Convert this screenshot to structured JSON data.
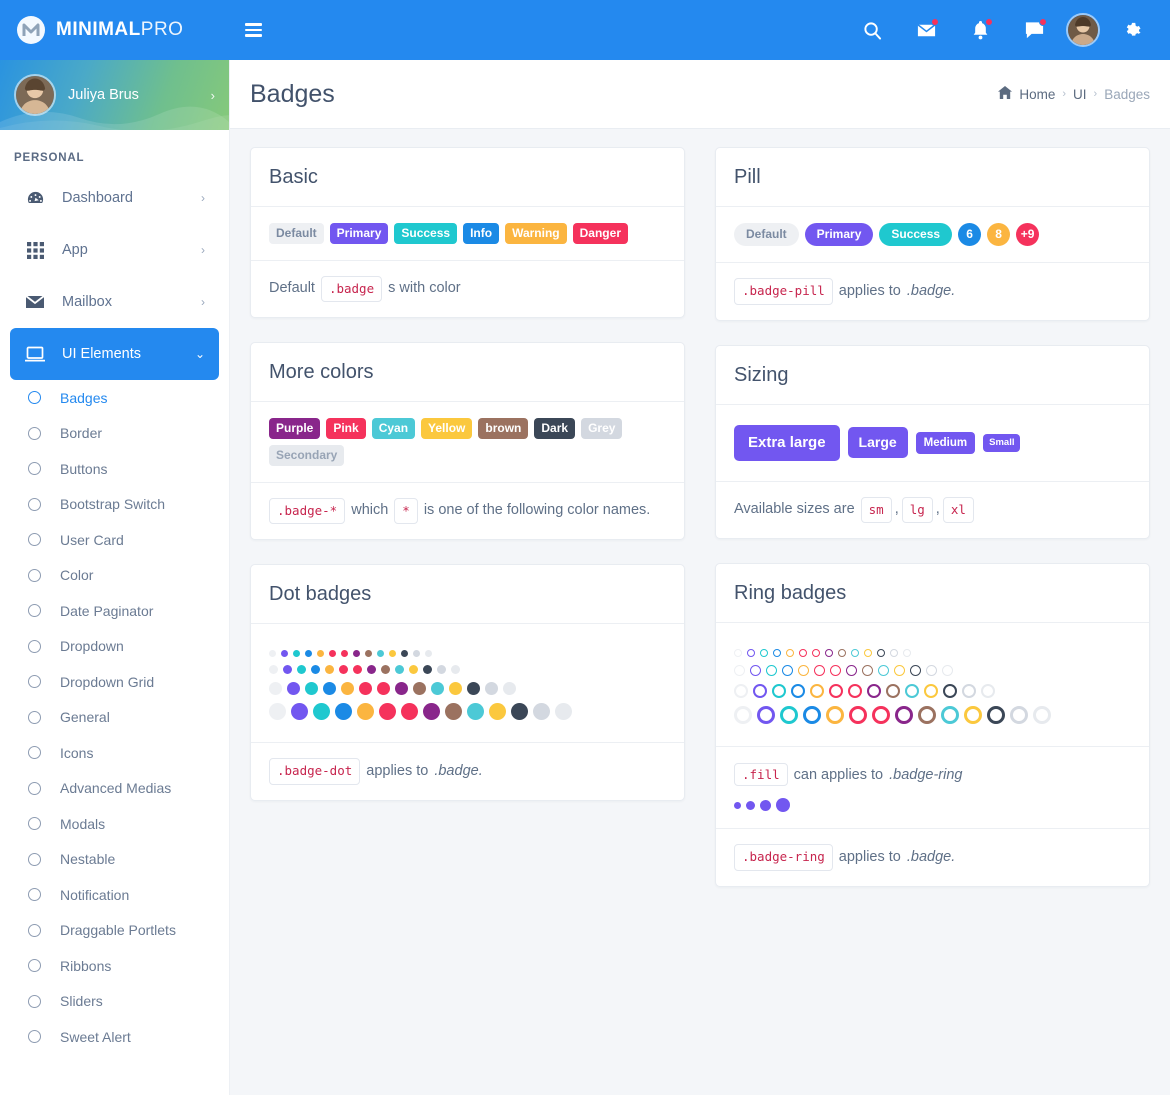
{
  "brand": {
    "name_bold": "MINIMAL",
    "name_light": "PRO",
    "logo_icon": "m-logo-icon"
  },
  "topbar": {
    "menu_icon": "hamburger-icon",
    "icons": [
      {
        "name": "search-icon",
        "badge": false
      },
      {
        "name": "mail-icon",
        "badge": true
      },
      {
        "name": "bell-icon",
        "badge": true
      },
      {
        "name": "chat-icon",
        "badge": true
      }
    ],
    "avatar_name": "user-avatar",
    "settings_icon": "gear-icon",
    "accent": "#2489ef"
  },
  "sidebar": {
    "user": {
      "name": "Juliya Brus",
      "chevron": "›"
    },
    "section_label": "PERSONAL",
    "items": [
      {
        "label": "Dashboard",
        "icon": "speedometer-icon",
        "chevron": "›",
        "active": false
      },
      {
        "label": "App",
        "icon": "grid-icon",
        "chevron": "›",
        "active": false
      },
      {
        "label": "Mailbox",
        "icon": "envelope-icon",
        "chevron": "›",
        "active": false
      },
      {
        "label": "UI Elements",
        "icon": "monitor-icon",
        "chevron": "⌄",
        "active": true
      }
    ],
    "subitems": [
      {
        "label": "Badges",
        "active": true
      },
      {
        "label": "Border",
        "active": false
      },
      {
        "label": "Buttons",
        "active": false
      },
      {
        "label": "Bootstrap Switch",
        "active": false
      },
      {
        "label": "User Card",
        "active": false
      },
      {
        "label": "Color",
        "active": false
      },
      {
        "label": "Date Paginator",
        "active": false
      },
      {
        "label": "Dropdown",
        "active": false
      },
      {
        "label": "Dropdown Grid",
        "active": false
      },
      {
        "label": "General",
        "active": false
      },
      {
        "label": "Icons",
        "active": false
      },
      {
        "label": "Advanced Medias",
        "active": false
      },
      {
        "label": "Modals",
        "active": false
      },
      {
        "label": "Nestable",
        "active": false
      },
      {
        "label": "Notification",
        "active": false
      },
      {
        "label": "Draggable Portlets",
        "active": false
      },
      {
        "label": "Ribbons",
        "active": false
      },
      {
        "label": "Sliders",
        "active": false
      },
      {
        "label": "Sweet Alert",
        "active": false
      }
    ]
  },
  "page": {
    "title": "Badges",
    "breadcrumb": {
      "home_icon": "home-icon",
      "home": "Home",
      "sep": "›",
      "middle": "UI",
      "current": "Badges"
    }
  },
  "palette": {
    "default": "#eef0f3",
    "default_text": "#7b8aa1",
    "primary": "#7257f0",
    "success": "#1fc8cf",
    "info": "#1b8ae5",
    "warning": "#fbb540",
    "danger": "#f5325c",
    "purple": "#89268b",
    "pink": "#f5325c",
    "cyan": "#4cc9d6",
    "yellow": "#fbc83e",
    "brown": "#9b7260",
    "dark": "#3b4757",
    "grey": "#d3d8e0",
    "secondary": "#e7eaee"
  },
  "cards": {
    "basic": {
      "title": "Basic",
      "badges": [
        {
          "label": "Default",
          "color": "default"
        },
        {
          "label": "Primary",
          "color": "primary"
        },
        {
          "label": "Success",
          "color": "success"
        },
        {
          "label": "Info",
          "color": "info"
        },
        {
          "label": "Warning",
          "color": "warning"
        },
        {
          "label": "Danger",
          "color": "danger"
        }
      ],
      "footer": {
        "pre": "Default",
        "code": ".badge",
        "post": "s with color"
      }
    },
    "pill": {
      "title": "Pill",
      "badges": [
        {
          "label": "Default",
          "color": "default",
          "shape": "pill"
        },
        {
          "label": "Primary",
          "color": "primary",
          "shape": "pill"
        },
        {
          "label": "Success",
          "color": "success",
          "shape": "pill"
        },
        {
          "label": "6",
          "color": "info",
          "shape": "circle"
        },
        {
          "label": "8",
          "color": "warning",
          "shape": "circle"
        },
        {
          "label": "+9",
          "color": "danger",
          "shape": "circle"
        }
      ],
      "footer": {
        "code": ".badge-pill",
        "post": "applies to",
        "em": ".badge."
      }
    },
    "more_colors": {
      "title": "More colors",
      "badges": [
        {
          "label": "Purple",
          "color": "purple"
        },
        {
          "label": "Pink",
          "color": "pink"
        },
        {
          "label": "Cyan",
          "color": "cyan"
        },
        {
          "label": "Yellow",
          "color": "yellow"
        },
        {
          "label": "brown",
          "color": "brown"
        },
        {
          "label": "Dark",
          "color": "dark"
        },
        {
          "label": "Grey",
          "color": "grey"
        },
        {
          "label": "Secondary",
          "color": "secondary"
        }
      ],
      "footer": {
        "code1": ".badge-*",
        "mid": "which",
        "code2": "*",
        "post": "is one of the following color names."
      }
    },
    "sizing": {
      "title": "Sizing",
      "badges": [
        {
          "label": "Extra large",
          "size": "xl"
        },
        {
          "label": "Large",
          "size": "lg"
        },
        {
          "label": "Medium",
          "size": "md"
        },
        {
          "label": "Small",
          "size": "sm"
        }
      ],
      "footer": {
        "pre": "Available sizes are",
        "codes": [
          "sm",
          "lg",
          "xl"
        ],
        "sep": ","
      }
    },
    "dot": {
      "title": "Dot badges",
      "colors": [
        "default",
        "primary",
        "success",
        "info",
        "warning",
        "danger",
        "pink",
        "purple",
        "brown",
        "cyan",
        "yellow",
        "dark",
        "grey",
        "secondary"
      ],
      "row_sizes": [
        7,
        9,
        13,
        17
      ],
      "footer": {
        "code": ".badge-dot",
        "post": "applies to",
        "em": ".badge."
      }
    },
    "ring": {
      "title": "Ring badges",
      "colors": [
        "default",
        "primary",
        "success",
        "info",
        "warning",
        "danger",
        "pink",
        "purple",
        "brown",
        "cyan",
        "yellow",
        "dark",
        "grey",
        "secondary"
      ],
      "row_sizes": [
        8,
        11,
        14,
        18
      ],
      "fill_note": {
        "code": ".fill",
        "post": "can applies to",
        "em": ".badge-ring"
      },
      "fill_sizes": [
        7,
        9,
        11,
        14
      ],
      "fill_color": "primary",
      "footer": {
        "code": ".badge-ring",
        "post": "applies to",
        "em": ".badge."
      }
    }
  }
}
